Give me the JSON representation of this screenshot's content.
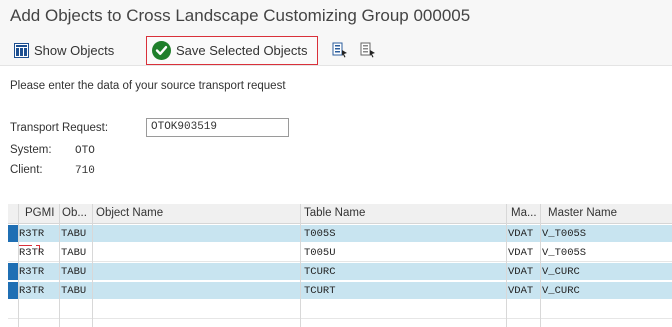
{
  "window": {
    "title": "Add Objects to Cross Landscape Customizing Group 000005"
  },
  "toolbar": {
    "show_objects": "Show Objects",
    "save_selected": "Save Selected Objects"
  },
  "form": {
    "prompt": "Please enter the data of your source transport request",
    "transport_request_label": "Transport Request:",
    "transport_request_value": "OTOK903519",
    "system_label": "System:",
    "system_value": "OTO",
    "client_label": "Client:",
    "client_value": "710"
  },
  "table": {
    "columns": [
      "PGMI",
      "Ob...",
      "Object Name",
      "Table Name",
      "Ma...",
      "Master Name"
    ],
    "rows": [
      {
        "pgmid": "R3TR",
        "object": "TABU",
        "object_name": "",
        "table_name": "T005S",
        "ma": "VDAT",
        "master_name": "V_T005S",
        "selected": true
      },
      {
        "pgmid": "R3TR",
        "object": "TABU",
        "object_name": "",
        "table_name": "T005U",
        "ma": "VDAT",
        "master_name": "V_T005S",
        "selected": false
      },
      {
        "pgmid": "R3TR",
        "object": "TABU",
        "object_name": "",
        "table_name": "TCURC",
        "ma": "VDAT",
        "master_name": "V_CURC",
        "selected": true
      },
      {
        "pgmid": "R3TR",
        "object": "TABU",
        "object_name": "",
        "table_name": "TCURT",
        "ma": "VDAT",
        "master_name": "V_CURC",
        "selected": true
      }
    ]
  },
  "colors": {
    "selected_row": "#c8e4f0",
    "selection_marker": "#1f6fb4",
    "highlight_border": "#d9303a",
    "check_green": "#1f7f2b"
  }
}
